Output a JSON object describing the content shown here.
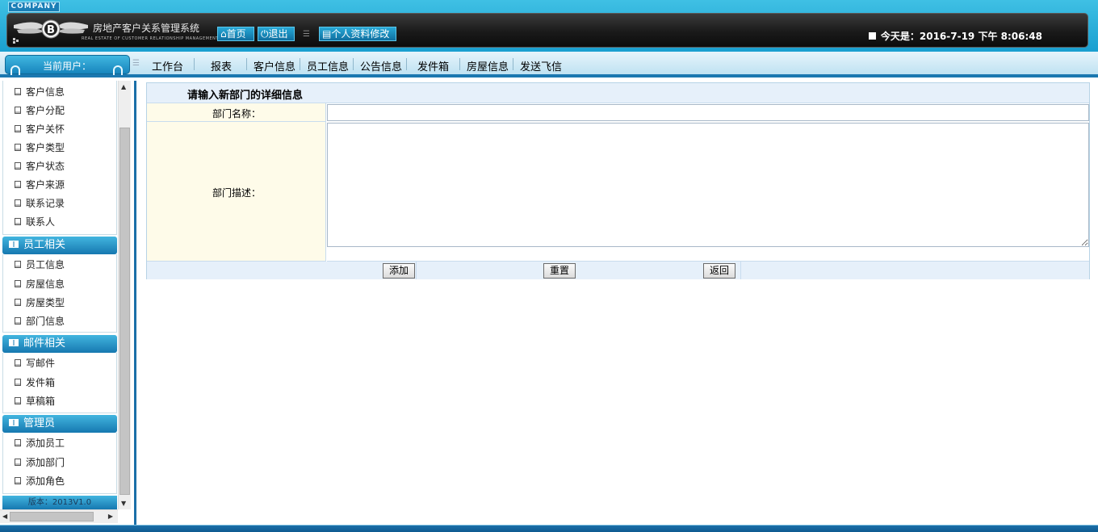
{
  "header": {
    "company_tab": "COMPANY",
    "title": "房地产客户关系管理系统",
    "subtitle": "REAL ESTATE OF CUSTOMER RELATIONSHIP MANAGEMENT SYSTEM",
    "home_label": "首页",
    "logout_label": "退出",
    "profile_label": "个人资料修改",
    "date_text": "今天是：2016-7-19 下午 8:06:48"
  },
  "nav": {
    "current_user_label": "当前用户：",
    "items": [
      "工作台",
      "报表",
      "客户信息",
      "员工信息",
      "公告信息",
      "发件箱",
      "房屋信息",
      "发送飞信"
    ]
  },
  "sidebar": {
    "customer_items": [
      "客户信息",
      "客户分配",
      "客户关怀",
      "客户类型",
      "客户状态",
      "客户来源",
      "联系记录",
      "联系人"
    ],
    "sections": [
      {
        "title": "员工相关",
        "items": [
          "员工信息",
          "房屋信息",
          "房屋类型",
          "部门信息"
        ]
      },
      {
        "title": "邮件相关",
        "items": [
          "写邮件",
          "发件箱",
          "草稿箱"
        ]
      },
      {
        "title": "管理员",
        "items": [
          "添加员工",
          "添加部门",
          "添加角色"
        ]
      }
    ],
    "version": "版本：2013V1.0"
  },
  "form": {
    "title": "请输入新部门的详细信息",
    "name_label": "部门名称：",
    "name_value": "",
    "desc_label": "部门描述：",
    "desc_value": "",
    "add_button": "添加",
    "reset_button": "重置",
    "back_button": "返回"
  },
  "colors": {
    "header_blue": "#1a9fd0",
    "nav_blue": "#1b78b0",
    "label_cell_bg": "#fefbe9",
    "row_bg": "#e6f0fa"
  },
  "icons": [
    "logo-emblem",
    "home-icon",
    "power-icon",
    "profile-icon",
    "document-icon",
    "book-icon"
  ]
}
